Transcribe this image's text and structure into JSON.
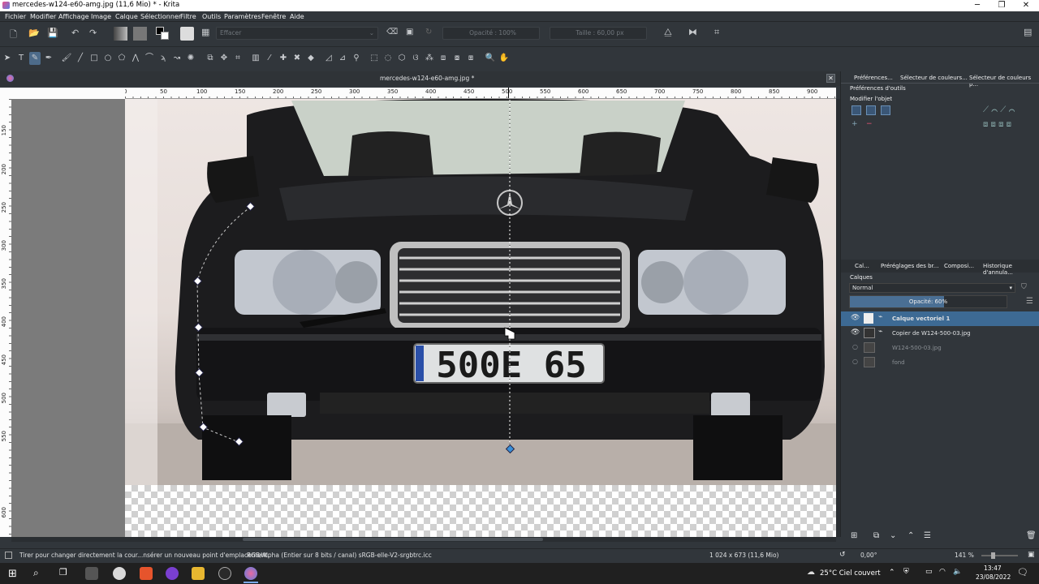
{
  "window": {
    "title": "mercedes-w124-e60-amg.jpg (11,6 Mio)  * - Krita"
  },
  "menu": [
    "Fichier",
    "Modifier",
    "Affichage",
    "Image",
    "Calque",
    "Sélectionner",
    "Filtre",
    "Outils",
    "Paramètres",
    "Fenêtre",
    "Aide"
  ],
  "toolbar": {
    "blend_mode": "Effacer",
    "opacity": "Opacité : 100%",
    "size": "Taille : 60,00 px"
  },
  "document": {
    "tab_title": "mercedes-w124-e60-amg.jpg *"
  },
  "ruler_h": [
    "0",
    "50",
    "100",
    "150",
    "200",
    "250",
    "300",
    "350",
    "400",
    "450",
    "500",
    "550",
    "600",
    "650",
    "700",
    "750",
    "800",
    "850",
    "900"
  ],
  "ruler_v": [
    "150",
    "200",
    "250",
    "300",
    "350",
    "400",
    "450",
    "500",
    "550",
    "600"
  ],
  "plate": "500E 65",
  "right_panel": {
    "top_tabs": [
      "Préférences...",
      "Sélecteur de couleurs...",
      "Sélecteur de couleurs p..."
    ],
    "tool_options_title": "Préférences d'outils",
    "modify_object": "Modifier l'objet",
    "layer_tabs": [
      "Cal...",
      "Préréglages des br...",
      "Composi...",
      "Historique d'annula..."
    ],
    "layers_title": "Calques",
    "blend": "Normal",
    "opacity": "Opacité:  60%",
    "opacity_value": 0.6,
    "layers": [
      {
        "name": "Calque vectoriel 1",
        "visible": true,
        "selected": true
      },
      {
        "name": "Copier de W124-500-03.jpg",
        "visible": true,
        "selected": false
      },
      {
        "name": "W124-500-03.jpg",
        "visible": false,
        "selected": false
      },
      {
        "name": "fond",
        "visible": false,
        "selected": false
      }
    ]
  },
  "status": {
    "hint": "Tirer pour changer directement la cour...nsérer un nouveau point d'emplacement.",
    "colorspace": "RGB/Alpha (Entier sur 8 bits / canal) sRGB-elle-V2-srgbtrc.icc",
    "dimensions": "1 024 x 673 (11,6 Mio)",
    "rotation": "0,00°",
    "zoom": "141 %"
  },
  "taskbar": {
    "weather": "25°C  Ciel couvert",
    "time": "13:47",
    "date": "23/08/2022"
  }
}
